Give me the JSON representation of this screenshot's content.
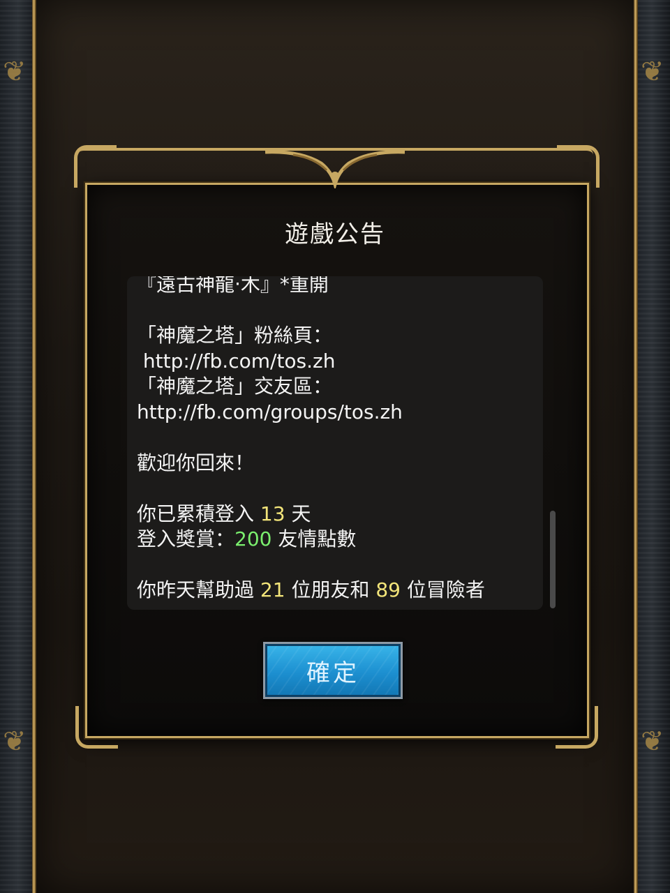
{
  "dialog": {
    "title": "遊戲公告",
    "lines": [
      {
        "parts": [
          {
            "text": "『遠古神龍‧木』*重開"
          }
        ]
      },
      {
        "parts": [
          {
            "text": ""
          }
        ]
      },
      {
        "parts": [
          {
            "text": "「神魔之塔」粉絲頁："
          }
        ]
      },
      {
        "parts": [
          {
            "text": " http://fb.com/tos.zh"
          }
        ]
      },
      {
        "parts": [
          {
            "text": "「神魔之塔」交友區："
          }
        ]
      },
      {
        "parts": [
          {
            "text": "http://fb.com/groups/tos.zh"
          }
        ]
      },
      {
        "parts": [
          {
            "text": ""
          }
        ]
      },
      {
        "parts": [
          {
            "text": "歡迎你回來！"
          }
        ]
      },
      {
        "parts": [
          {
            "text": ""
          }
        ]
      },
      {
        "parts": [
          {
            "text": "你已累積登入 "
          },
          {
            "text": "13",
            "color": "yellow"
          },
          {
            "text": " 天"
          }
        ]
      },
      {
        "parts": [
          {
            "text": "登入獎賞："
          },
          {
            "text": "200",
            "color": "green"
          },
          {
            "text": " 友情點數"
          }
        ]
      },
      {
        "parts": [
          {
            "text": ""
          }
        ]
      },
      {
        "parts": [
          {
            "text": "你昨天幫助過 "
          },
          {
            "text": "21",
            "color": "yellow"
          },
          {
            "text": " 位朋友和 "
          },
          {
            "text": "89",
            "color": "yellow"
          },
          {
            "text": " 位冒險者"
          }
        ]
      }
    ],
    "confirm_label": "確定"
  },
  "colors": {
    "gold_trim": "#c7a862",
    "highlight_yellow": "#f3e57a",
    "highlight_green": "#7bef6e",
    "button_blue": "#1c8fd0"
  }
}
